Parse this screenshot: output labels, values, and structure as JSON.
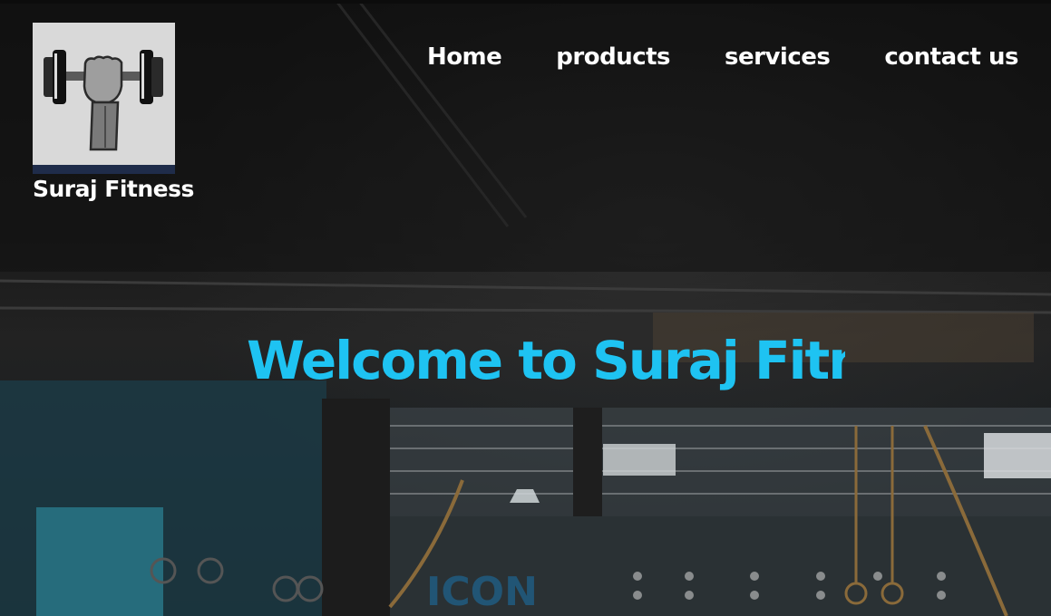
{
  "logo": {
    "icon": "dumbbell-fist-icon",
    "brand_name": "Suraj Fitness"
  },
  "nav": {
    "items": [
      {
        "label": "Home"
      },
      {
        "label": "products"
      },
      {
        "label": "services"
      },
      {
        "label": "contact us"
      }
    ]
  },
  "hero": {
    "headline": "Welcome to Suraj Fitness",
    "background": "gym-interior-photo"
  },
  "colors": {
    "accent": "#1ec3f2",
    "nav_text": "#ffffff",
    "background": "#141414"
  }
}
